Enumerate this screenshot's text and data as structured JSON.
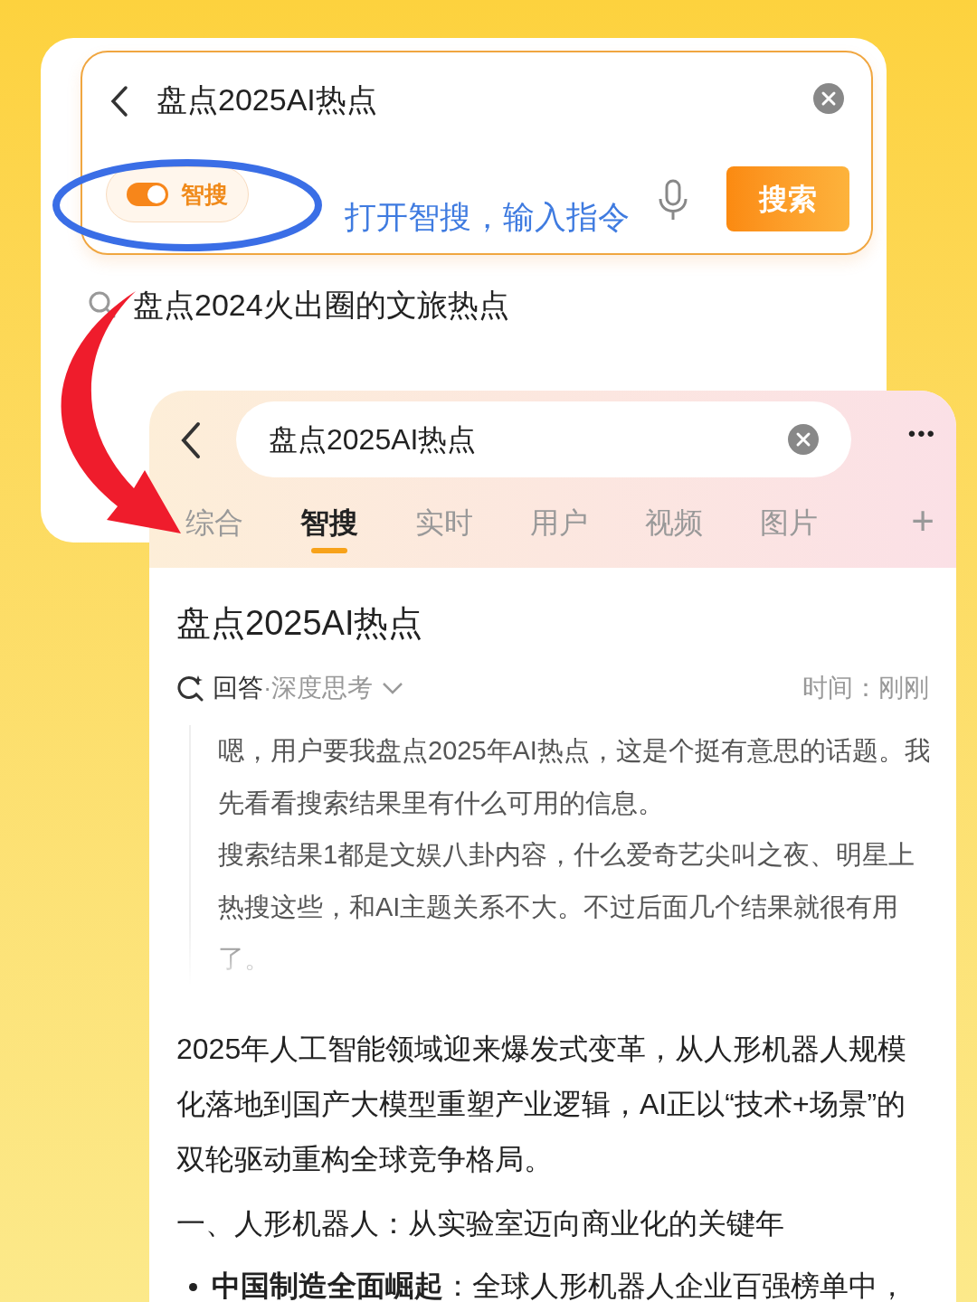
{
  "search_screen": {
    "query": "盘点2025AI热点",
    "smart_search_toggle": {
      "label": "智搜",
      "on": true
    },
    "hint": "打开智搜，输入指令",
    "search_button": "搜索",
    "suggestions": [
      "盘点2024火出圈的文旅热点"
    ]
  },
  "results_screen": {
    "query": "盘点2025AI热点",
    "more": "•••",
    "tabs": [
      {
        "label": "综合",
        "selected": false
      },
      {
        "label": "智搜",
        "selected": true
      },
      {
        "label": "实时",
        "selected": false
      },
      {
        "label": "用户",
        "selected": false
      },
      {
        "label": "视频",
        "selected": false
      },
      {
        "label": "图片",
        "selected": false
      }
    ],
    "add_tab": "+",
    "title": "盘点2025AI热点",
    "answer_label": "回答",
    "answer_mode": "·深度思考",
    "time": "时间：刚刚",
    "thinking": [
      "嗯，用户要我盘点2025年AI热点，这是个挺有意思的话题。我先看看搜索结果里有什么可用的信息。",
      "搜索结果1都是文娱八卦内容，什么爱奇艺尖叫之夜、明星上热搜这些，和AI主题关系不大。不过后面几个结果就很有用了。"
    ],
    "answer": "2025年人工智能领域迎来爆发式变革，从人形机器人规模化落地到国产大模型重塑产业逻辑，AI正以“技术+场景”的双轮驱动重构全球竞争格局。",
    "section": "一、人形机器人：从实验室迈向商业化的关键年",
    "bullets": [
      "**中国制造全面崛起**：全球人形机器人企业百强榜单中，"
    ]
  }
}
